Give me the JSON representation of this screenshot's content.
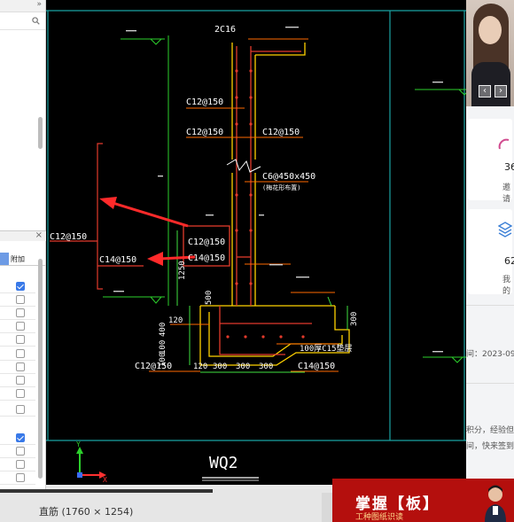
{
  "left_panel": {
    "collapse_glyph": "»",
    "close_glyph": "×",
    "column_label": "附加",
    "rows": [
      {
        "checked": true
      },
      {
        "checked": false
      },
      {
        "checked": false
      },
      {
        "checked": false
      },
      {
        "checked": false
      },
      {
        "checked": false
      },
      {
        "checked": false
      },
      {
        "checked": false
      },
      {
        "checked": false
      },
      {
        "checked": false
      },
      {
        "checked": true
      },
      {
        "checked": false
      },
      {
        "checked": false
      },
      {
        "checked": false
      }
    ]
  },
  "drawing": {
    "title": "WQ2",
    "labels": {
      "top_bar": "2C16",
      "c12_1": "C12@150",
      "c12_2": "C12@150",
      "c12_3": "C12@150",
      "c6": "C6@450x450",
      "c6_sub": "(梅花形布置)",
      "c12_mid": "C12@150",
      "c14_mid": "C14@150",
      "c12_left": "C12@150",
      "c14_left": "C14@150",
      "dim_1250": "1250",
      "dim_500": "500",
      "dim_120": "120",
      "dim_400": "400",
      "dim_100a": "100",
      "dim_100b": "100",
      "dim_300": "300",
      "dim_300r": "300",
      "c15": "100厚C15垫层",
      "bot_c12": "C12@150",
      "bot_dims": [
        "120",
        "300",
        "300",
        "300"
      ],
      "bot_c14": "C14@150",
      "axis_y": "Y",
      "axis_x": "X"
    }
  },
  "right_panel": {
    "stat1": "36",
    "stat1_sub": "邀请",
    "stat2": "62",
    "stat2_sub": "我的",
    "date_text": "间：2023-09",
    "text1": "积分，经验但",
    "text2": "间，快来签到"
  },
  "bottom": {
    "caption": "直筋 (1760 × 1254)",
    "banner_title": "掌握【板】",
    "banner_sub": "工种图纸识读"
  },
  "colors": {
    "cad_bg": "#000000",
    "frame": "#1aa3a3",
    "wall_outline": "#ffd200",
    "rebar": "#e23a2c",
    "leader": "#ff6a00",
    "label": "#ffffff",
    "dim": "#3fe03f",
    "arrow": "#ff2a2a",
    "note": "#d0d0d0",
    "checkbox": "#3979e8",
    "banner": "#b40f0d"
  }
}
